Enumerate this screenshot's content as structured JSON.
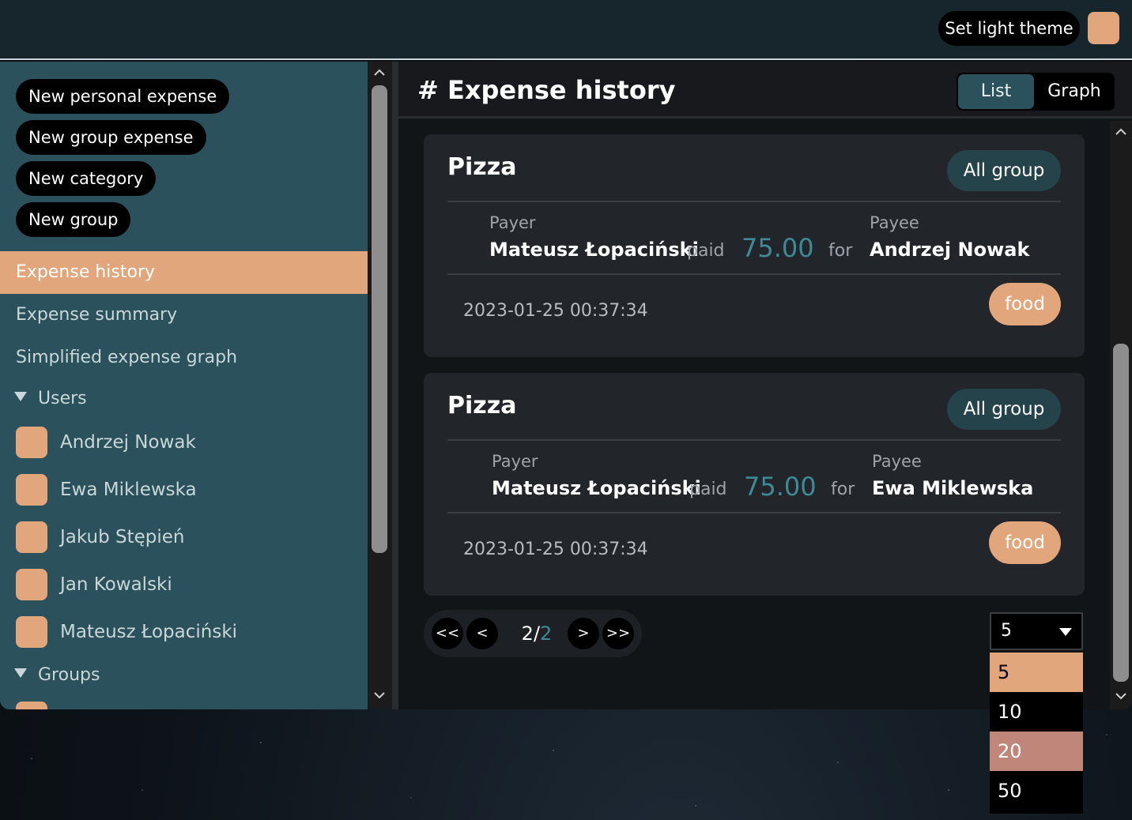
{
  "topbar": {
    "theme_button": "Set light theme",
    "theme_swatch_color": "#e1a67b"
  },
  "sidebar": {
    "actions": [
      {
        "label": "New personal expense"
      },
      {
        "label": "New group expense"
      },
      {
        "label": "New category"
      },
      {
        "label": "New group"
      }
    ],
    "nav": [
      {
        "label": "Expense history",
        "active": true
      },
      {
        "label": "Expense summary",
        "active": false
      },
      {
        "label": "Simplified expense graph",
        "active": false
      }
    ],
    "users_heading": "Users",
    "users": [
      {
        "name": "Andrzej Nowak"
      },
      {
        "name": "Ewa Miklewska"
      },
      {
        "name": "Jakub Stępień"
      },
      {
        "name": "Jan Kowalski"
      },
      {
        "name": "Mateusz Łopaciński"
      }
    ],
    "groups_heading": "Groups"
  },
  "main": {
    "title": "# Expense history",
    "view_toggle": {
      "list": "List",
      "graph": "Graph",
      "active": "List"
    },
    "expenses": [
      {
        "title": "Pizza",
        "group": "All group",
        "payer_label": "Payer",
        "payer": "Mateusz Łopaciński",
        "paid_word": "paid",
        "amount": "75.00",
        "for_word": "for",
        "payee_label": "Payee",
        "payee": "Andrzej Nowak",
        "timestamp": "2023-01-25 00:37:34",
        "category": "food"
      },
      {
        "title": "Pizza",
        "group": "All group",
        "payer_label": "Payer",
        "payer": "Mateusz Łopaciński",
        "paid_word": "paid",
        "amount": "75.00",
        "for_word": "for",
        "payee_label": "Payee",
        "payee": "Ewa Miklewska",
        "timestamp": "2023-01-25 00:37:34",
        "category": "food"
      }
    ],
    "pagination": {
      "first": "<<",
      "prev": "<",
      "current": "2",
      "separator": "/",
      "total": "2",
      "next": ">",
      "last": ">>"
    },
    "page_size": {
      "value": "5",
      "options": [
        "5",
        "10",
        "20",
        "50"
      ]
    }
  },
  "colors": {
    "accent": "#e1a67b",
    "teal": "#2b525c",
    "amount": "#3e8a96",
    "hover_option": "#c0867a"
  }
}
